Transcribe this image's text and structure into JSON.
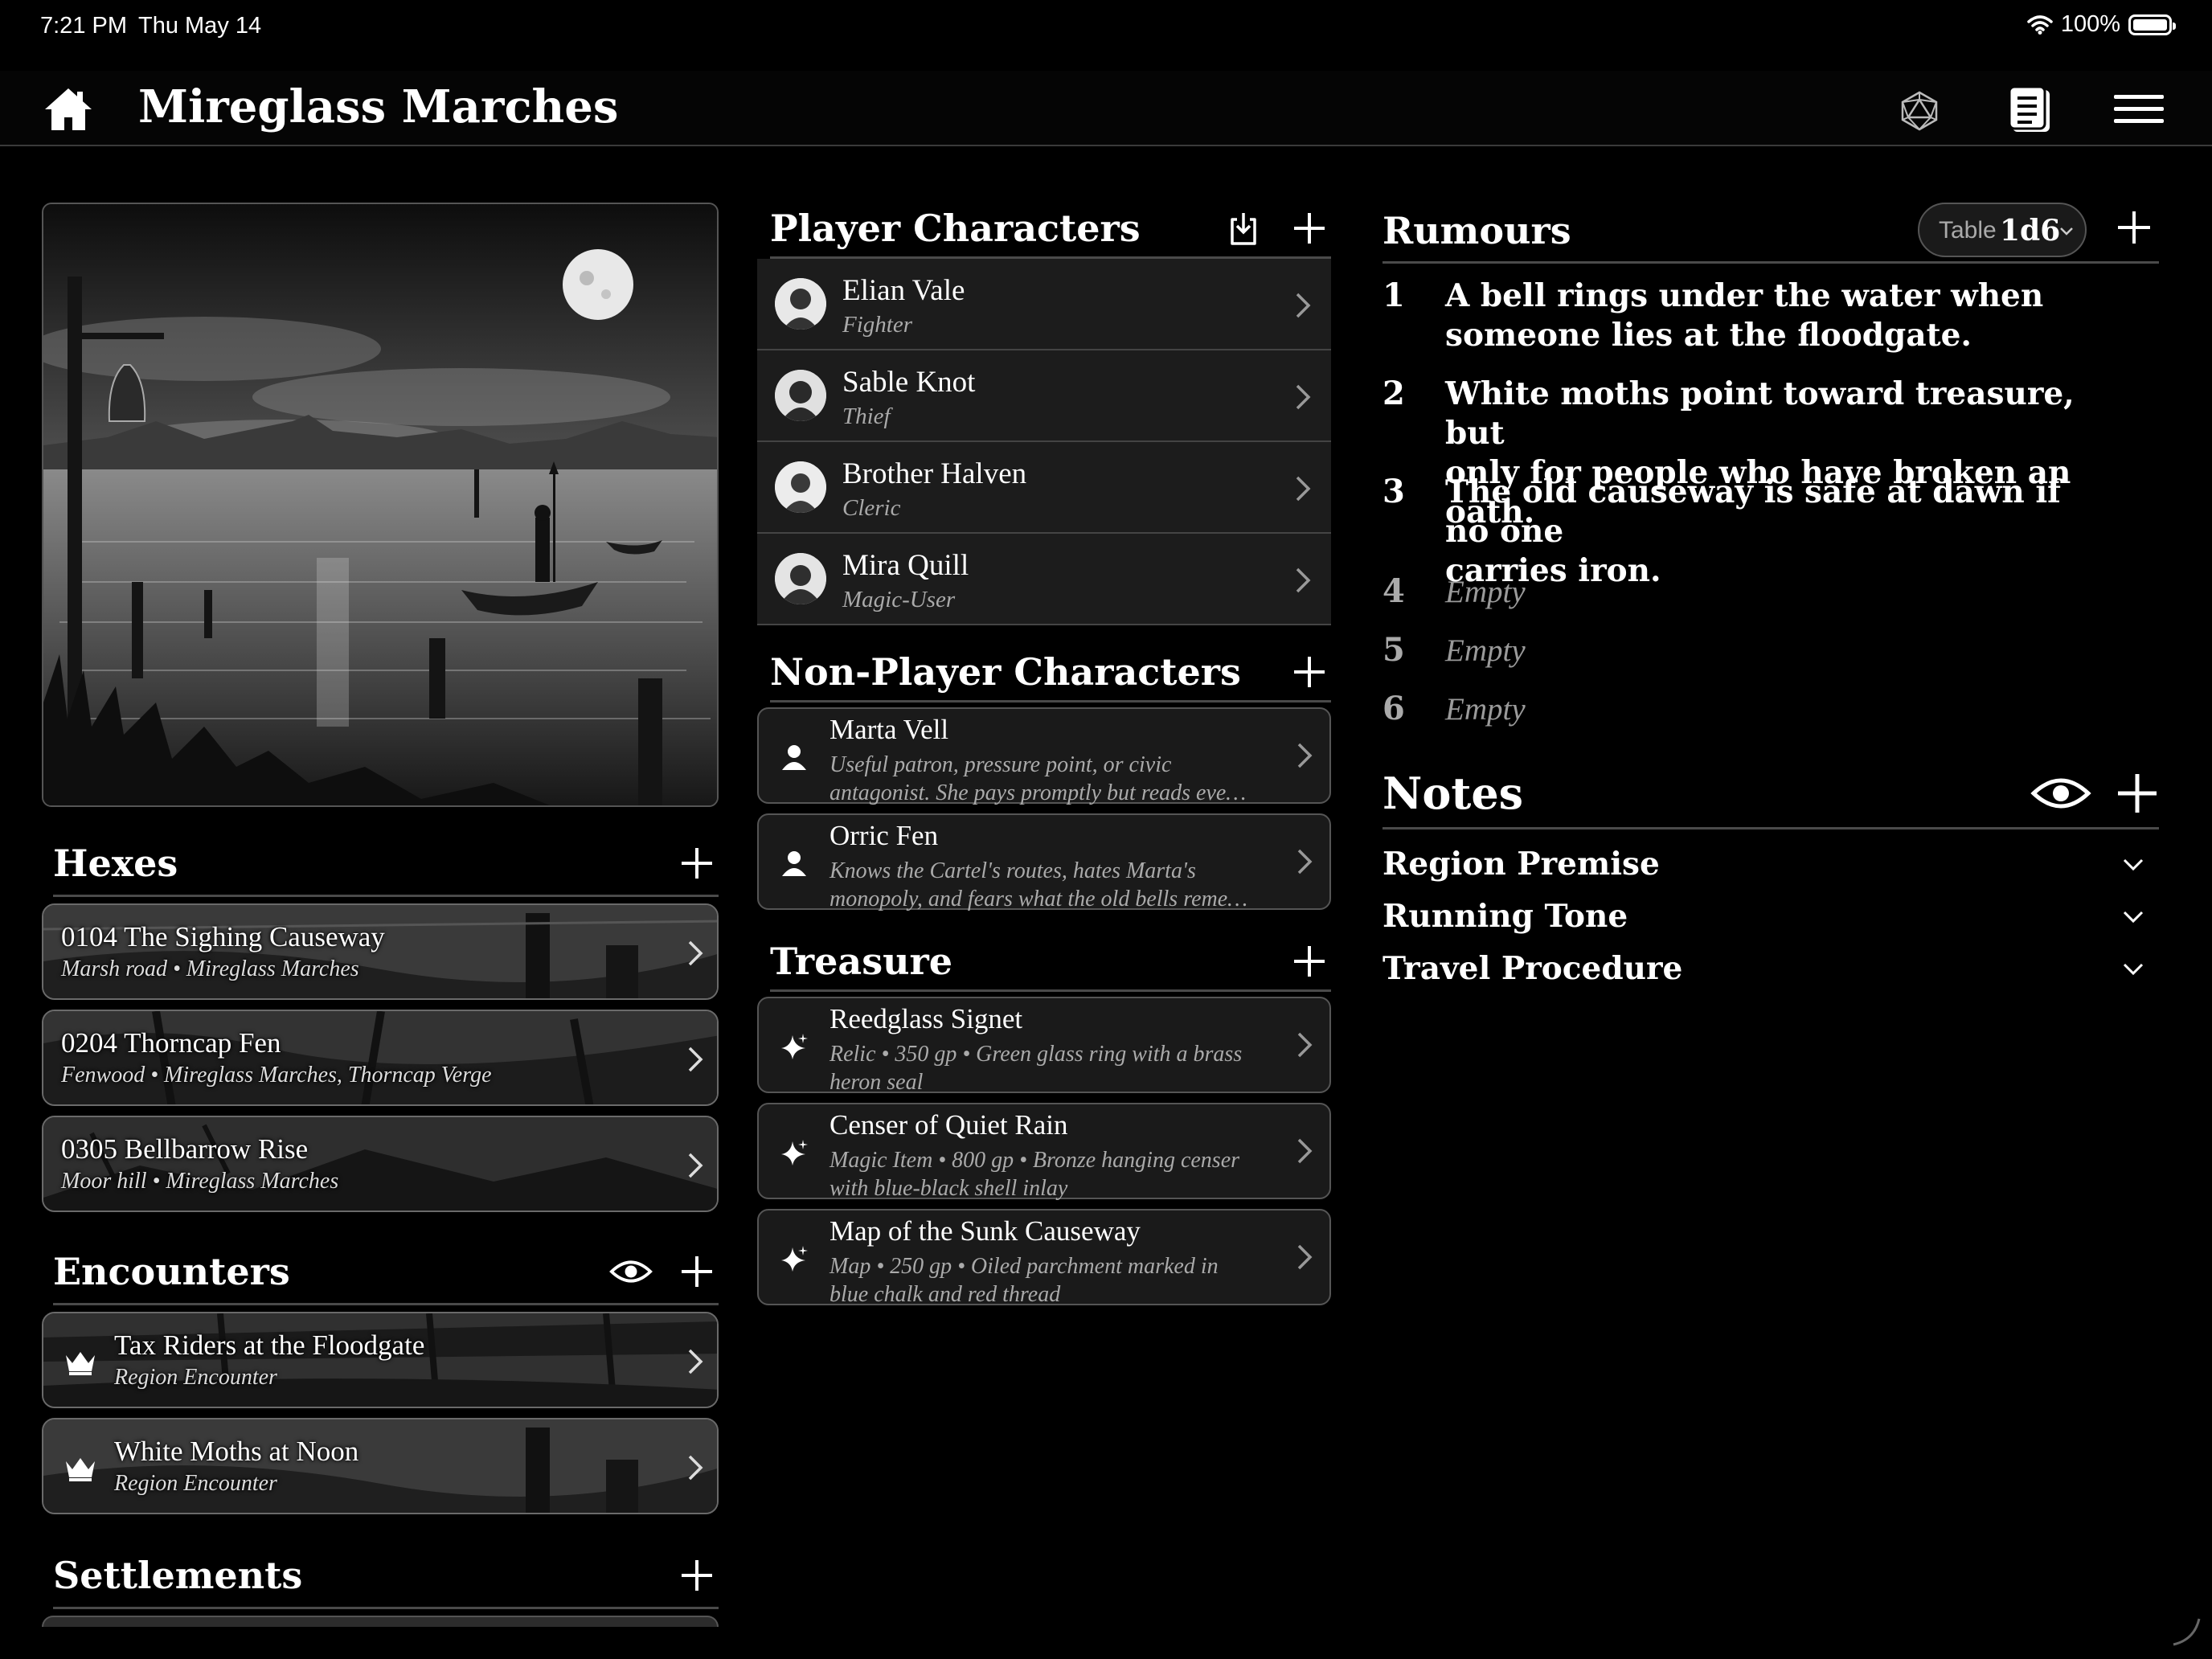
{
  "status": {
    "time": "7:21 PM",
    "date": "Thu May 14",
    "battery": "100%"
  },
  "nav": {
    "title": "Mireglass Marches",
    "icons": [
      "home-icon",
      "d20-icon",
      "journal-icon",
      "menu-icon"
    ]
  },
  "hexes": {
    "title": "Hexes",
    "items": [
      {
        "name": "0104 The Sighing Causeway",
        "sub": "Marsh road • Mireglass Marches"
      },
      {
        "name": "0204 Thorncap Fen",
        "sub": "Fenwood • Mireglass Marches, Thorncap Verge"
      },
      {
        "name": "0305 Bellbarrow Rise",
        "sub": "Moor hill • Mireglass Marches"
      }
    ]
  },
  "encounters": {
    "title": "Encounters",
    "items": [
      {
        "name": "Tax Riders at the Floodgate",
        "sub": "Region Encounter"
      },
      {
        "name": "White Moths at Noon",
        "sub": "Region Encounter"
      }
    ]
  },
  "settlements": {
    "title": "Settlements"
  },
  "pcs": {
    "title": "Player Characters",
    "items": [
      {
        "name": "Elian Vale",
        "cls": "Fighter"
      },
      {
        "name": "Sable Knot",
        "cls": "Thief"
      },
      {
        "name": "Brother Halven",
        "cls": "Cleric"
      },
      {
        "name": "Mira Quill",
        "cls": "Magic-User"
      }
    ]
  },
  "npcs": {
    "title": "Non-Player Characters",
    "items": [
      {
        "name": "Marta Vell",
        "line1": "Useful patron, pressure point, or civic",
        "line2": "antagonist. She pays promptly but reads eve…"
      },
      {
        "name": "Orric Fen",
        "line1": "Knows the Cartel's routes, hates Marta's",
        "line2": "monopoly, and fears what the old bells reme…"
      }
    ]
  },
  "treasure": {
    "title": "Treasure",
    "items": [
      {
        "name": "Reedglass Signet",
        "line1": "Relic • 350 gp • Green glass ring with a brass",
        "line2": "heron seal"
      },
      {
        "name": "Censer of Quiet Rain",
        "line1": "Magic Item • 800 gp • Bronze hanging censer",
        "line2": "with blue-black shell inlay"
      },
      {
        "name": "Map of the Sunk Causeway",
        "line1": "Map • 250 gp • Oiled parchment marked in",
        "line2": "blue chalk and red thread"
      }
    ]
  },
  "rumours": {
    "title": "Rumours",
    "table_label": "Table",
    "table_die": "1d6",
    "items": [
      {
        "num": "1",
        "line1": "A bell rings under the water when",
        "line2": "someone lies at the floodgate."
      },
      {
        "num": "2",
        "line1": "White moths point toward treasure, but",
        "line2": "only for people who have broken an oath."
      },
      {
        "num": "3",
        "line1": "The old causeway is safe at dawn if no one",
        "line2": "carries iron."
      },
      {
        "num": "4",
        "line1": "Empty",
        "line2": ""
      },
      {
        "num": "5",
        "line1": "Empty",
        "line2": ""
      },
      {
        "num": "6",
        "line1": "Empty",
        "line2": ""
      }
    ]
  },
  "notes": {
    "title": "Notes",
    "items": [
      "Region Premise",
      "Running Tone",
      "Travel Procedure"
    ]
  },
  "colors": {
    "background": "#000000",
    "card": "#1a1a1a",
    "divider": "#4a4a4a",
    "text": "#ffffff",
    "muted": "#aaaaaa"
  }
}
